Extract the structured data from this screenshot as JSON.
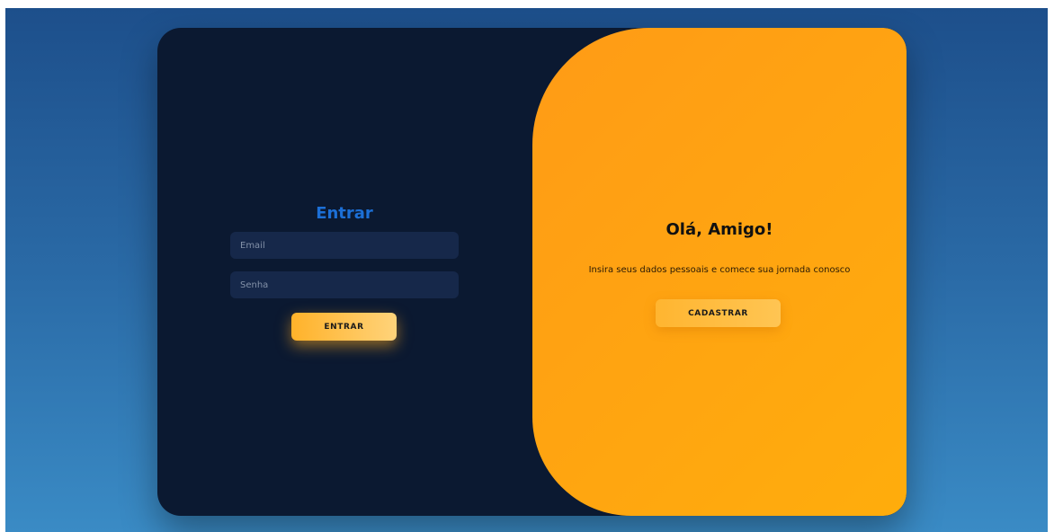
{
  "login": {
    "title": "Entrar",
    "email_placeholder": "Email",
    "password_placeholder": "Senha",
    "submit_label": "ENTRAR"
  },
  "signup": {
    "title": "Olá, Amigo!",
    "description": "Insira seus dados pessoais e comece sua jornada conosco",
    "button_label": "CADASTRAR"
  },
  "colors": {
    "background_top": "#1d4f8b",
    "background_bottom": "#3a8bc5",
    "card_dark": "#0b1931",
    "accent_orange": "#ffa50f",
    "title_blue": "#1c6fd6"
  }
}
